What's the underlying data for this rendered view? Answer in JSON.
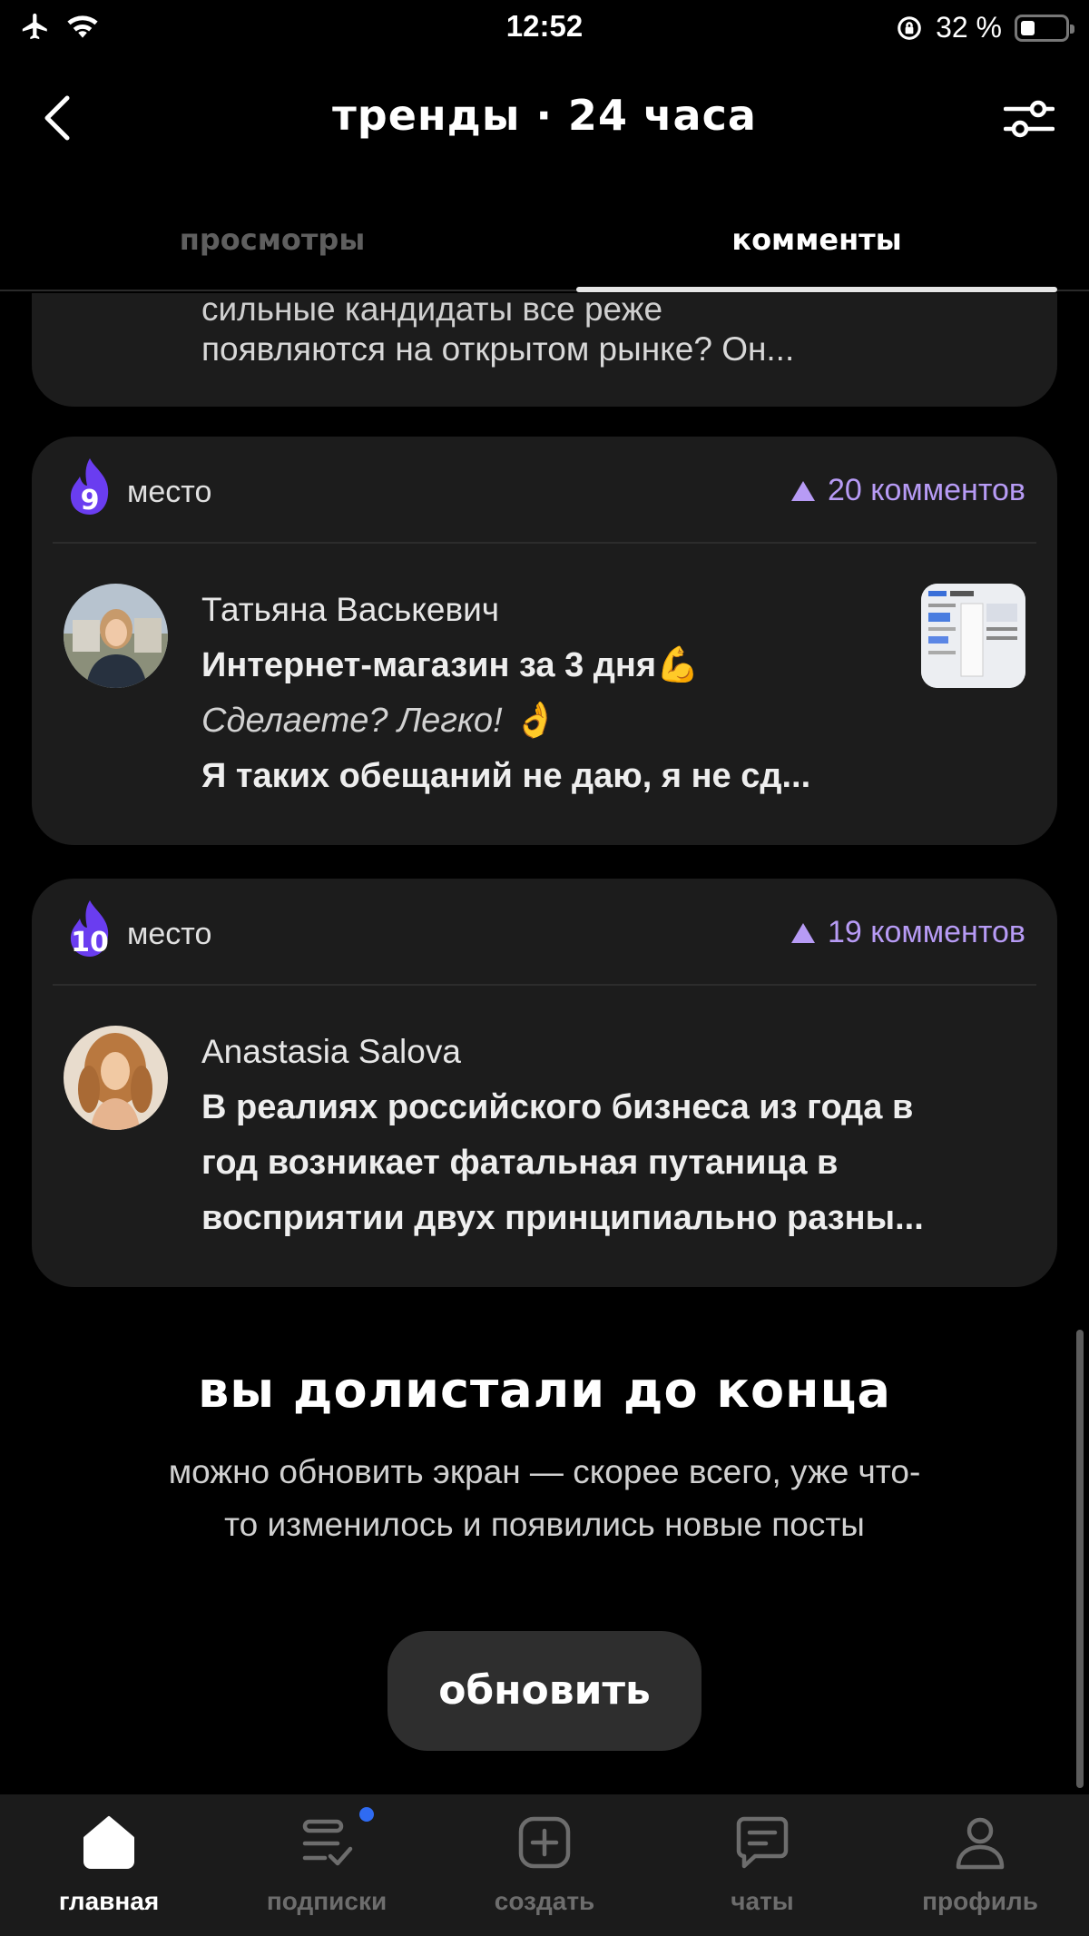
{
  "status_bar": {
    "time": "12:52",
    "battery": "32 %",
    "battery_level": 0.32
  },
  "header": {
    "title": "тренды · 24 часа"
  },
  "tabs": [
    {
      "label": "просмотры",
      "active": false
    },
    {
      "label": "комменты",
      "active": true
    }
  ],
  "feed": {
    "partial_card": {
      "line_cut": "сильные кандидаты все реже",
      "line_last": "появляются на открытом рынке? Он..."
    },
    "cards": [
      {
        "place": "9",
        "place_label": "место",
        "comments": "20 комментов",
        "author": "Татьяна Васькевич",
        "line1": "Интернет-магазин за 3 дня💪",
        "line2": "Сделаете? Легко! 👌",
        "line3": "Я таких обещаний не даю, я не сд..."
      },
      {
        "place": "10",
        "place_label": "место",
        "comments": "19 комментов",
        "author": "Anastasia Salova",
        "line1": "В реалиях российского бизнеса из года в",
        "line2": "год возникает фатальная путаница в",
        "line3": "восприятии двух принципиально разны..."
      }
    ]
  },
  "end": {
    "title": "вы долистали до конца",
    "subtitle_1": "можно обновить экран — скорее всего, уже что-",
    "subtitle_2": "то изменилось и появились новые посты",
    "refresh_label": "обновить"
  },
  "bottom_nav": [
    {
      "label": "главная",
      "icon": "home-icon",
      "active": true
    },
    {
      "label": "подписки",
      "icon": "subscriptions-icon",
      "badge": true
    },
    {
      "label": "создать",
      "icon": "create-icon"
    },
    {
      "label": "чаты",
      "icon": "chat-icon"
    },
    {
      "label": "профиль",
      "icon": "profile-icon"
    }
  ],
  "colors": {
    "accent": "#b79bf5",
    "fire": "#6a3df0",
    "badge_dot": "#2f6bf2",
    "card_bg": "#1c1c1c"
  }
}
